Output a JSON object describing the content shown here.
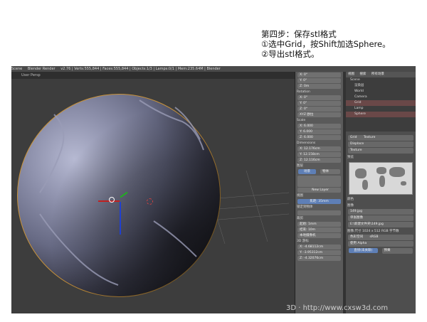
{
  "caption": {
    "line1": "第四步：保存stl格式",
    "line2": "①选中Grid，按Shift加选Sphere。",
    "line3": "②导出stl格式。"
  },
  "app": {
    "topbar": [
      "Scene",
      "Blender Render",
      "v2.76 | Verts:555,844 | Faces:555,844 | Objects:1/3 | Lamps:0/1 | Mem:235.64M | Blender"
    ],
    "viewport_header": "User Persp"
  },
  "props": {
    "rows": [
      "X: 0°",
      "Y: 0°",
      "Z: 0m",
      "Rotation",
      "X: 0°",
      "Y: 0°",
      "Z: 0°",
      "XYZ 欧拉",
      "Scale",
      "X: 6.000",
      "Y: 6.000",
      "Z: 6.000",
      "Dimensions",
      "X: 12.176cm",
      "Y: 12.158cm",
      "Z: 12.116cm"
    ],
    "layers_label": "图层",
    "btn_scene": "场景",
    "btn_local": "物体",
    "new_layer": "New Layer",
    "view_label": "视图",
    "lens": "焦距: 35mm",
    "lock": "锁定到物体",
    "clip_label": "裁剪",
    "clip_start": "起始: 1mm",
    "clip_end": "结束: 10m",
    "camera": "本地摄像机",
    "world_label": "3D 游标",
    "cursor_x": "X: -4.68112cm",
    "cursor_y": "Y: -3.95312cm",
    "cursor_z": "Z: -4.32076cm"
  },
  "outliner": {
    "tabs": [
      "视图",
      "搜索",
      "所有场景"
    ],
    "items": [
      "Scene",
      "渲染层",
      "World",
      "Camera",
      "Grid",
      "Lamp",
      "Sphere"
    ]
  },
  "rpanel": {
    "tabs": [
      "Grid",
      "Texture"
    ],
    "displace": "Displace",
    "texture": "Texture",
    "preview": "预览",
    "colors": "颜色",
    "image_label": "图像",
    "image_file": "149.jpg",
    "image_type": "单张图像",
    "path": "E:\\新建文件夹\\149.jpg",
    "info": "图像:尺寸 1024 x 512 RGB 字节数",
    "colorspace_label": "色彩空间",
    "colorspace": "sRGB",
    "alpha": "使用 Alpha",
    "straight": "直接(未关联)",
    "premul": "预乘"
  },
  "watermark": "3D · http://www.cxsw3d.com"
}
